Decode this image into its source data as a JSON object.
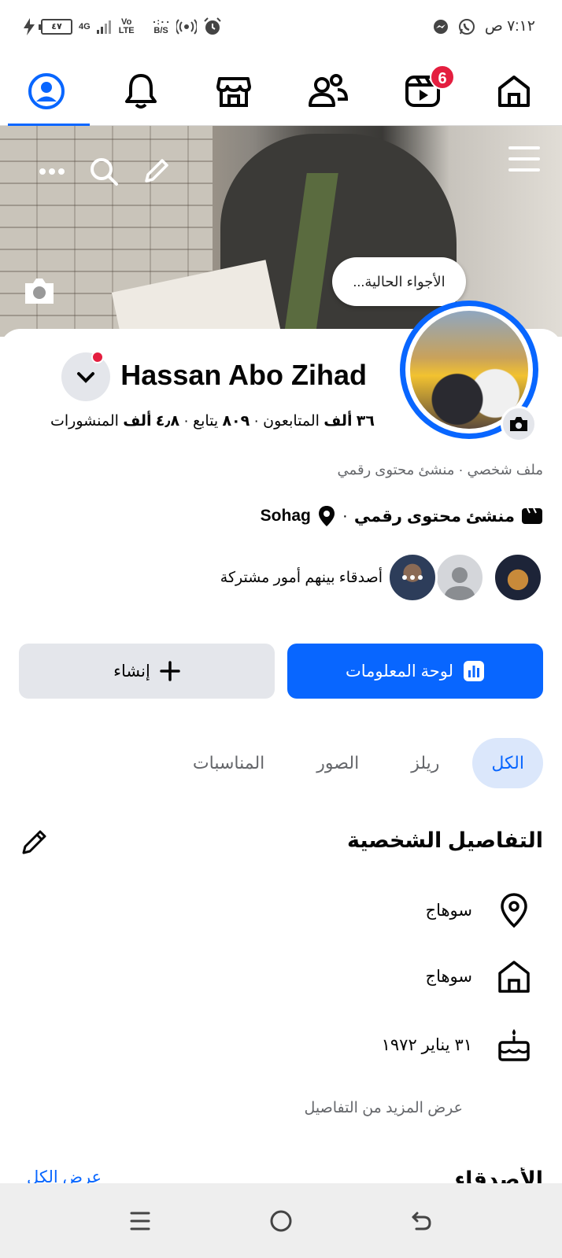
{
  "status_bar": {
    "time": "٧:١٢ ص",
    "battery": "٤٧",
    "network": "4G",
    "volte": "Vo\nLTE",
    "speed": "B/S",
    "speed_value": "٠:٠٠"
  },
  "top_nav": {
    "items": [
      {
        "name": "profile",
        "icon": "profile-icon",
        "active": true
      },
      {
        "name": "notifications",
        "icon": "bell-icon"
      },
      {
        "name": "marketplace",
        "icon": "store-icon"
      },
      {
        "name": "friends",
        "icon": "friends-icon"
      },
      {
        "name": "video",
        "icon": "video-icon",
        "badge": "6"
      },
      {
        "name": "home",
        "icon": "home-icon"
      }
    ]
  },
  "cover": {
    "mood_bubble": "الأجواء الحالية..."
  },
  "profile": {
    "name": "Hassan Abo Zihad",
    "stats": {
      "posts_value": "٤٫٨",
      "posts_unit": "ألف",
      "posts_label": "المنشورات",
      "following_value": "٨٠٩",
      "following_label": "يتابع",
      "followers_value": "٣٦",
      "followers_unit": "ألف",
      "followers_label": "المتابعون",
      "separator": "·"
    },
    "subtitle": "ملف شخصي · منشئ محتوى رقمي",
    "category": "منشئ محتوى رقمي",
    "location": "Sohag",
    "mutual_text": "أصدقاء بينهم أمور مشتركة"
  },
  "actions": {
    "dashboard_label": "لوحة المعلومات",
    "create_label": "إنشاء"
  },
  "tabs": [
    {
      "label": "الكل",
      "active": true
    },
    {
      "label": "ريلز"
    },
    {
      "label": "الصور"
    },
    {
      "label": "المناسبات"
    }
  ],
  "details": {
    "title": "التفاصيل الشخصية",
    "items": [
      {
        "icon": "location-pin-icon",
        "text": "سوهاج"
      },
      {
        "icon": "home-icon",
        "text": "سوهاج"
      },
      {
        "icon": "birthday-cake-icon",
        "text": "٣١ يناير ١٩٧٢"
      }
    ],
    "see_more": "عرض المزيد من التفاصيل"
  },
  "friends": {
    "title": "الأصدقاء",
    "see_all": "عرض الكل"
  },
  "colors": {
    "accent": "#0866ff",
    "badge": "#e41e3f",
    "secondary_button": "#e4e6eb",
    "muted_text": "#65676b"
  }
}
